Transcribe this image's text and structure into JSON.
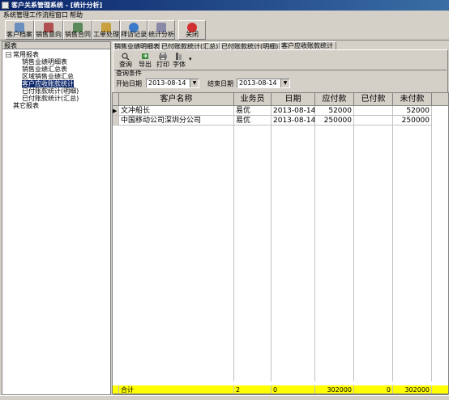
{
  "window": {
    "title": "客户关系管理系统 - [统计分析]"
  },
  "menu": [
    "系统管理",
    "工作流程",
    "窗口",
    "帮助"
  ],
  "toolbar": [
    {
      "label": "客户档案",
      "icon": "folder-icon",
      "color": "#6a8fbf"
    },
    {
      "label": "销售意向",
      "icon": "phone-icon",
      "color": "#b05050"
    },
    {
      "label": "销售合同",
      "icon": "contract-icon",
      "color": "#5a8a5a"
    },
    {
      "label": "工单处理",
      "icon": "ticket-icon",
      "color": "#c8a040"
    },
    {
      "label": "拜访记录",
      "icon": "globe-icon",
      "color": "#3a7ac8"
    },
    {
      "label": "统计分析",
      "icon": "chart-icon",
      "color": "#8a8aa8"
    },
    {
      "label": "关闭",
      "icon": "close-icon",
      "color": "#d03030"
    }
  ],
  "left_panel": {
    "header": "报表",
    "tree": [
      {
        "label": "常用报表",
        "level": 0,
        "expanded": true
      },
      {
        "label": "销售业绩明细表",
        "level": 1
      },
      {
        "label": "销售业绩汇总表",
        "level": 1
      },
      {
        "label": "区域销售业绩汇总",
        "level": 1
      },
      {
        "label": "客户应收账款统计",
        "level": 1,
        "selected": true
      },
      {
        "label": "已付账款统计(明细)",
        "level": 1
      },
      {
        "label": "已付账款统计(汇总)",
        "level": 1
      },
      {
        "label": "其它报表",
        "level": 0
      }
    ]
  },
  "tabs": [
    {
      "label": "销售业绩明细表"
    },
    {
      "label": "已付账款统计(汇总)"
    },
    {
      "label": "已付账款统计(明细)"
    },
    {
      "label": "客户应收账款统计",
      "active": true
    }
  ],
  "subtoolbar": [
    {
      "label": "查询",
      "icon": "search-icon"
    },
    {
      "label": "导出",
      "icon": "export-icon"
    },
    {
      "label": "打印",
      "icon": "print-icon"
    },
    {
      "label": "字体",
      "icon": "font-icon"
    }
  ],
  "query": {
    "group_label": "查询条件",
    "start_label": "开始日期",
    "start_value": "2013-08-14",
    "end_label": "结束日期",
    "end_value": "2013-08-14"
  },
  "grid": {
    "columns": [
      "客户名称",
      "业务员",
      "日期",
      "应付款",
      "已付款",
      "未付款"
    ],
    "rows": [
      [
        "文冲船长",
        "易优",
        "2013-08-14",
        "52000",
        "",
        "52000"
      ],
      [
        "中国移动公司深圳分公司",
        "易优",
        "2013-08-14",
        "250000",
        "",
        "250000"
      ]
    ],
    "totals": [
      "合计",
      "2",
      "0",
      "302000",
      "0",
      "302000"
    ]
  },
  "colors": {
    "highlight": "#0a246a",
    "total_row": "#ffff00"
  }
}
